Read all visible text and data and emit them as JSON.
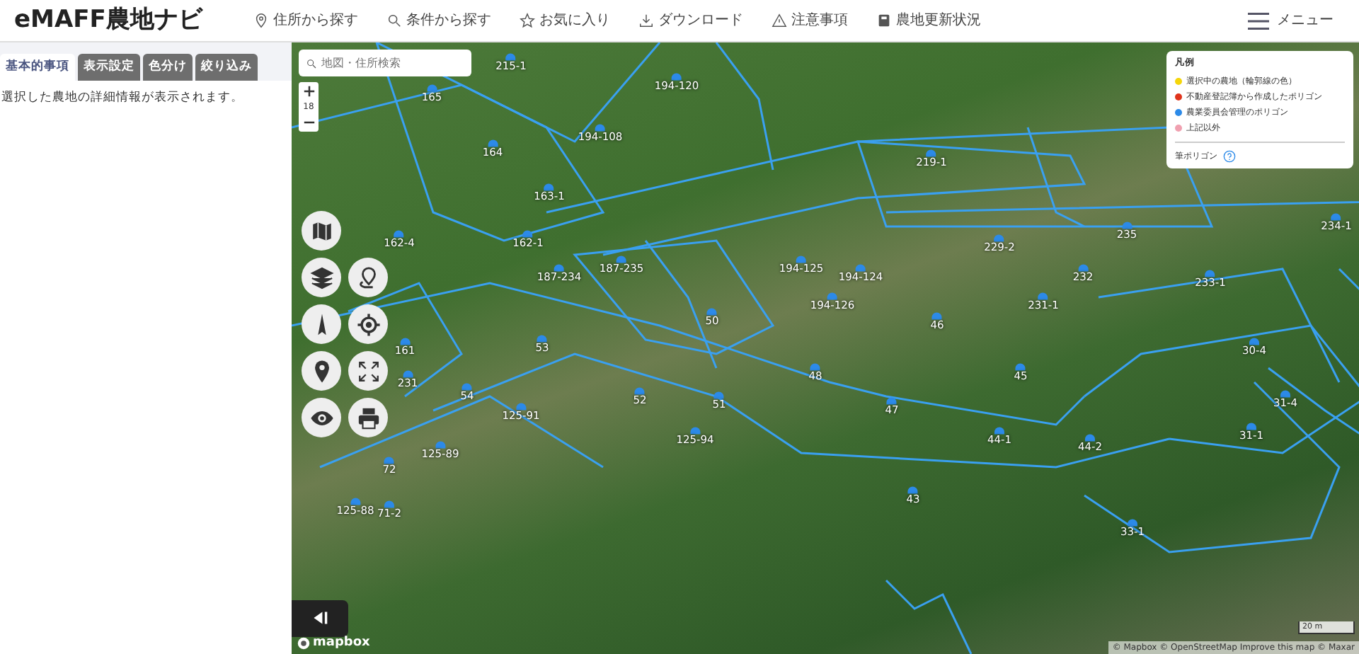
{
  "header": {
    "logo": "eMAFF農地ナビ",
    "nav": [
      "住所から探す",
      "条件から探す",
      "お気に入り",
      "ダウンロード",
      "注意事項",
      "農地更新状況"
    ],
    "menu": "メニュー"
  },
  "sidebar": {
    "tabs": [
      {
        "label": "基本的事項",
        "selected": true
      },
      {
        "label": "表示設定",
        "selected": false
      },
      {
        "label": "色分け",
        "selected": false
      },
      {
        "label": "絞り込み",
        "selected": false
      }
    ],
    "message": "選択した農地の詳細情報が表示されます。"
  },
  "map": {
    "search": {
      "placeholder": "地図・住所検索"
    },
    "zoom_level": "18",
    "legend": {
      "title": "凡例",
      "items": [
        {
          "label": "選択中の農地（輪郭線の色）",
          "color": "#f5d60a"
        },
        {
          "label": "不動産登記簿から作成したポリゴン",
          "color": "#e0341c"
        },
        {
          "label": "農業委員会管理のポリゴン",
          "color": "#2c8ae8"
        },
        {
          "label": "上記以外",
          "color": "#f0a0b0"
        }
      ],
      "footer": "筆ポリゴン"
    },
    "parcels": [
      "215-1",
      "165",
      "194-120",
      "194-108",
      "164",
      "219-1",
      "163-1",
      "162-4",
      "162-1",
      "187-234",
      "187-235",
      "194-125",
      "194-124",
      "229-2",
      "235",
      "234-1",
      "232",
      "233-1",
      "194-126",
      "231-1",
      "50",
      "46",
      "161",
      "53",
      "30-4",
      "231",
      "48",
      "45",
      "52",
      "51",
      "54",
      "47",
      "31-4",
      "125-91",
      "31-1",
      "44-1",
      "44-2",
      "125-94",
      "125-89",
      "72",
      "43",
      "125-88",
      "71-2",
      "33-1"
    ],
    "scale": "20 m",
    "attribution": "© Mapbox © OpenStreetMap Improve this map © Maxar",
    "brand": "mapbox"
  }
}
